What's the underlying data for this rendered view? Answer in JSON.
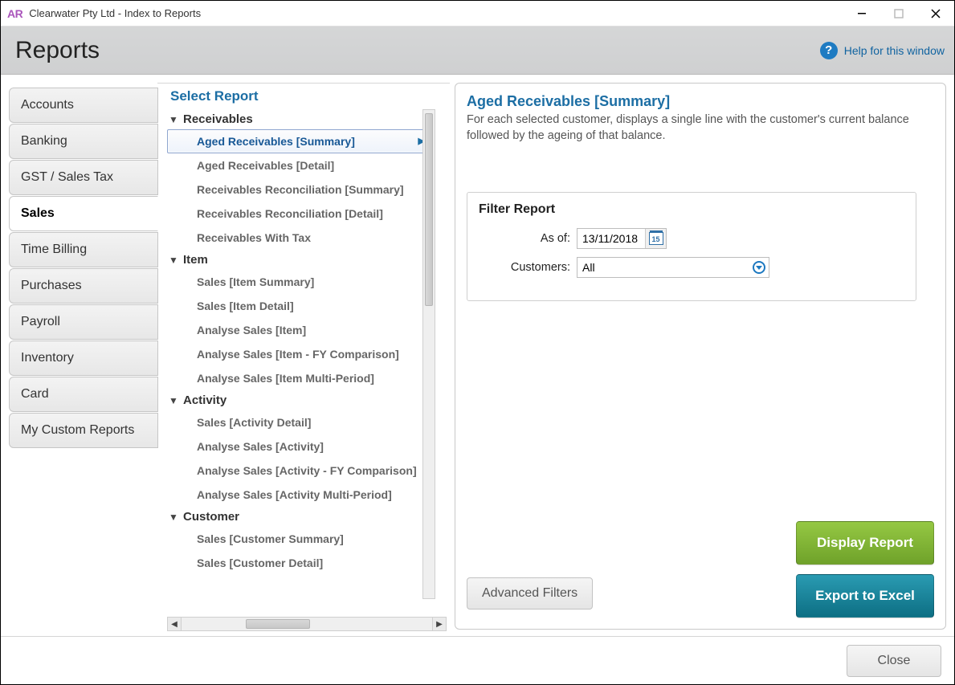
{
  "window": {
    "app_prefix": "AR",
    "title": "Clearwater Pty Ltd - Index to Reports"
  },
  "header": {
    "title": "Reports",
    "help_text": "Help for this window"
  },
  "left_nav": [
    {
      "label": "Accounts",
      "active": false
    },
    {
      "label": "Banking",
      "active": false
    },
    {
      "label": "GST / Sales Tax",
      "active": false
    },
    {
      "label": "Sales",
      "active": true
    },
    {
      "label": "Time Billing",
      "active": false
    },
    {
      "label": "Purchases",
      "active": false
    },
    {
      "label": "Payroll",
      "active": false
    },
    {
      "label": "Inventory",
      "active": false
    },
    {
      "label": "Card",
      "active": false
    },
    {
      "label": "My Custom Reports",
      "active": false
    }
  ],
  "select_report_title": "Select Report",
  "report_groups": [
    {
      "name": "Receivables",
      "items": [
        "Aged Receivables [Summary]",
        "Aged Receivables [Detail]",
        "Receivables Reconciliation [Summary]",
        "Receivables Reconciliation [Detail]",
        "Receivables With Tax"
      ]
    },
    {
      "name": "Item",
      "items": [
        "Sales [Item Summary]",
        "Sales [Item Detail]",
        "Analyse Sales [Item]",
        "Analyse Sales [Item - FY Comparison]",
        "Analyse Sales [Item Multi-Period]"
      ]
    },
    {
      "name": "Activity",
      "items": [
        "Sales [Activity Detail]",
        "Analyse Sales [Activity]",
        "Analyse Sales [Activity - FY Comparison]",
        "Analyse Sales [Activity Multi-Period]"
      ]
    },
    {
      "name": "Customer",
      "items": [
        "Sales [Customer Summary]",
        "Sales [Customer Detail]"
      ]
    }
  ],
  "selected_report_path": "report_groups.0.items.0",
  "detail": {
    "title": "Aged Receivables [Summary]",
    "description": "For each selected customer, displays a single line with the customer's current balance followed by the ageing of that balance."
  },
  "filter": {
    "title": "Filter Report",
    "as_of_label": "As of:",
    "as_of_value": "13/11/2018",
    "calendar_day": "15",
    "customers_label": "Customers:",
    "customers_value": "All"
  },
  "buttons": {
    "advanced_filters": "Advanced Filters",
    "display_report": "Display Report",
    "export_to_excel": "Export to Excel",
    "close": "Close"
  }
}
